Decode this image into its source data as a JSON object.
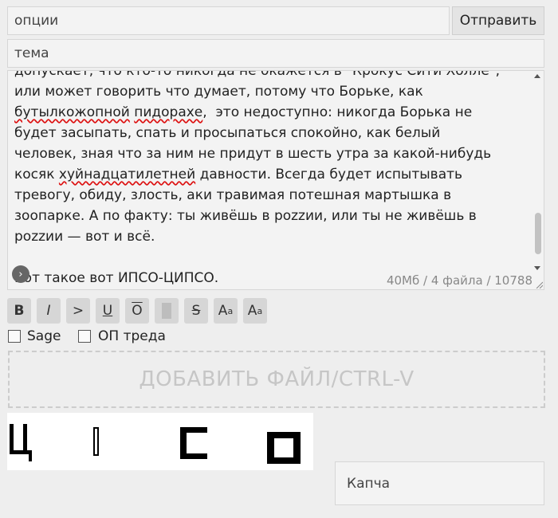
{
  "form": {
    "options_placeholder": "опции",
    "send_label": "Отправить",
    "subject_placeholder": "тема",
    "captcha_placeholder": "Капча"
  },
  "comment": {
    "line_1": "допускает, что кто-то никогда не окажется в \"Крокус Сити Холле\",",
    "line_2": "или может говорить что думает, потому что Борьке, как",
    "line_3a": "бутылкожопной",
    "line_3b": "пидорахе",
    "line_3c": ",  это недоступно: никогда Борька не",
    "line_4": "будет засыпать, спать и просыпаться спокойно, как белый",
    "line_5": "человек, зная что за ним не придут в шесть утра за какой-нибудь",
    "line_6a": "косяк ",
    "line_6b": "хуйнадцатилетней",
    "line_6c": " давности. Всегда будет испытывать",
    "line_7": "тревогу, обиду, злость, аки травимая потешная мартышка в",
    "line_8": "зоопарке. А по факту: ты живёшь в pozzии, или ты не живёшь в",
    "line_9": "pozzии — вот и всё.",
    "line_10": "",
    "line_11": "Вот такое вот ИПСО-ЦИПСО."
  },
  "status_text": "40Мб / 4 файла / 10788",
  "toolbar": {
    "bold": "B",
    "italic": "I",
    "quote": ">",
    "underline": "U",
    "overline": "O",
    "strike": "S",
    "sup": "A",
    "sup_small": "a",
    "sub": "A",
    "sub_small": "a"
  },
  "checkboxes": {
    "sage": "Sage",
    "op": "ОП треда"
  },
  "dropzone_label": "ДОБАВИТЬ ФАЙЛ/CTRL-V",
  "colors": {
    "background": "#eeeeee",
    "field": "#f3f3f3",
    "button": "#d6d6d6",
    "spellcheck": "#dd1111"
  }
}
